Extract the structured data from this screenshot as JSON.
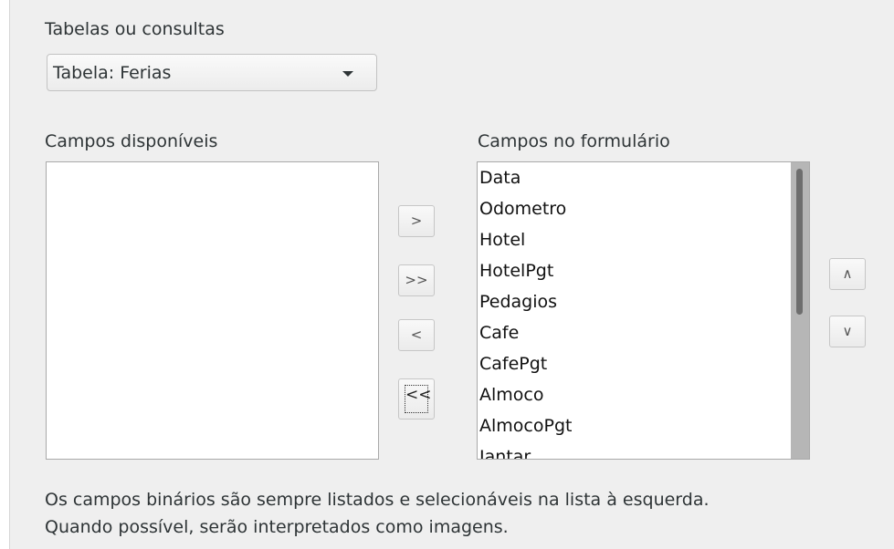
{
  "tables": {
    "label": "Tabelas ou consultas",
    "selected": "Tabela: Ferias"
  },
  "available": {
    "label": "Campos disponíveis",
    "items": []
  },
  "form_fields": {
    "label": "Campos no formulário",
    "items": [
      "Data",
      "Odometro",
      "Hotel",
      "HotelPgt",
      "Pedagios",
      "Cafe",
      "CafePgt",
      "Almoco",
      "AlmocoPgt",
      "Jantar"
    ]
  },
  "buttons": {
    "move_right": ">",
    "move_all_right": ">>",
    "move_left": "<",
    "move_all_left": "<<",
    "move_up": "∧",
    "move_down": "∨"
  },
  "notes": {
    "line1": "Os campos binários são sempre listados e selecionáveis na lista à esquerda.",
    "line2": "Quando possível, serão interpretados como imagens."
  }
}
